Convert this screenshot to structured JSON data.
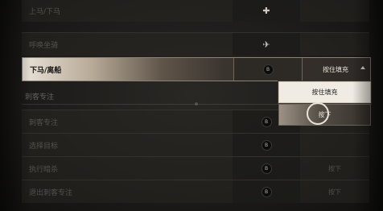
{
  "top_rows": [
    {
      "label": "上马/下马",
      "key_icon": "swap-icon"
    },
    {
      "label": "呼唤坐骑",
      "key_icon": "mount-icon"
    }
  ],
  "active_row": {
    "label": "下马/离船",
    "key": "B",
    "value": "按住填充"
  },
  "dropdown_options": [
    {
      "label": "按住填充",
      "selected": true
    },
    {
      "label": "按下",
      "selected": false
    }
  ],
  "section": {
    "title": "刺客专注"
  },
  "section_rows": [
    {
      "label": "刺客专注",
      "key": "B",
      "value": ""
    },
    {
      "label": "选择目标",
      "key": "B",
      "value": ""
    },
    {
      "label": "执行暗杀",
      "key": "B",
      "value": "按下"
    },
    {
      "label": "退出刺客专注",
      "key": "B",
      "value": "按下"
    }
  ]
}
